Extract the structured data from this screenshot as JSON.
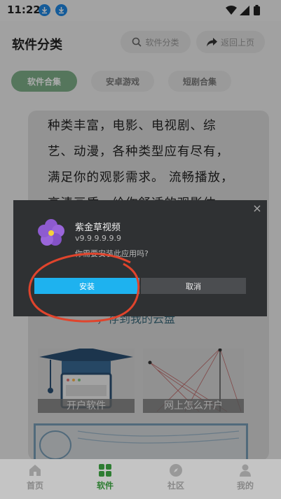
{
  "status_bar": {
    "time": "11:22"
  },
  "header": {
    "title": "软件分类",
    "search_label": "软件分类",
    "back_label": "返回上页"
  },
  "tabs": [
    {
      "label": "软件合集",
      "active": true
    },
    {
      "label": "安卓游戏",
      "active": false
    },
    {
      "label": "短剧合集",
      "active": false
    }
  ],
  "content": {
    "description_lines": [
      "种类丰富，电影、电视剧、综",
      "艺、动漫，各种类型应有尽有，",
      "满足你的观影需求。 流畅播放，",
      "高清画质，给你舒适的观影体"
    ],
    "link_text": "，存到我的云盘",
    "thumbnails": [
      {
        "label": "开户软件"
      },
      {
        "label": "网上怎么开户"
      }
    ]
  },
  "dialog": {
    "app_name": "紫金草视频",
    "version": "v9.9.9.9.9.9",
    "question": "你需要安装此应用吗?",
    "install_label": "安装",
    "cancel_label": "取消",
    "close_symbol": "×"
  },
  "bottom_nav": [
    {
      "label": "首页",
      "icon": "home-icon",
      "active": false
    },
    {
      "label": "软件",
      "icon": "grid-icon",
      "active": true
    },
    {
      "label": "社区",
      "icon": "compass-icon",
      "active": false
    },
    {
      "label": "我的",
      "icon": "person-icon",
      "active": false
    }
  ],
  "colors": {
    "accent_green": "#7fb08a",
    "install_blue": "#1eb2ef",
    "annotation_red": "#e0442c"
  }
}
